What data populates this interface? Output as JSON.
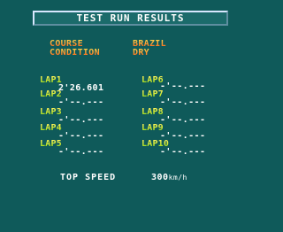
{
  "title": "TEST RUN RESULTS",
  "info": {
    "course_label": "COURSE",
    "course_value": "BRAZIL",
    "condition_label": "CONDITION",
    "condition_value": "DRY"
  },
  "laps": [
    {
      "label": "LAP1",
      "time": "2'26.601"
    },
    {
      "label": "LAP2",
      "time": "-'--.---"
    },
    {
      "label": "LAP3",
      "time": "-'--.---"
    },
    {
      "label": "LAP4",
      "time": "-'--.---"
    },
    {
      "label": "LAP5",
      "time": "-'--.---"
    },
    {
      "label": "LAP6",
      "time": "-'--.---"
    },
    {
      "label": "LAP7",
      "time": "-'--.---"
    },
    {
      "label": "LAP8",
      "time": "-'--.---"
    },
    {
      "label": "LAP9",
      "time": "-'--.---"
    },
    {
      "label": "LAP10",
      "time": "-'--.---"
    }
  ],
  "top_speed": {
    "label": "TOP SPEED",
    "value": "300",
    "unit": "km/h"
  }
}
